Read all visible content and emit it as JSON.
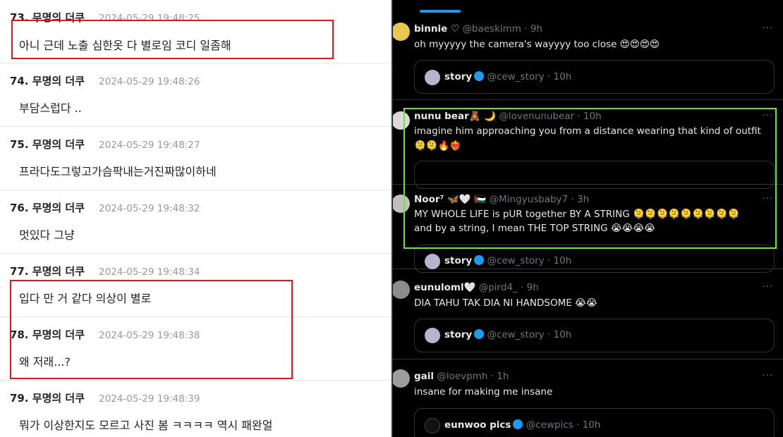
{
  "left": {
    "comments": [
      {
        "name": "73. 무명의 더쿠",
        "date": "2024-05-29 19:48:25",
        "text": "아니 근데 노출 심한옷 다 별로임 코디 일좀해"
      },
      {
        "name": "74. 무명의 더쿠",
        "date": "2024-05-29 19:48:26",
        "text": "부담스럽다 .."
      },
      {
        "name": "75. 무명의 더쿠",
        "date": "2024-05-29 19:48:27",
        "text": "프라다도그렇고가슴팍내는거진짜많이하네"
      },
      {
        "name": "76. 무명의 더쿠",
        "date": "2024-05-29 19:48:32",
        "text": "멋있다 그냥"
      },
      {
        "name": "77. 무명의 더쿠",
        "date": "2024-05-29 19:48:34",
        "text": "입다 만 거 같다 의상이 별로"
      },
      {
        "name": "78. 무명의 더쿠",
        "date": "2024-05-29 19:48:38",
        "text": "왜 저래...?"
      },
      {
        "name": "79. 무명의 더쿠",
        "date": "2024-05-29 19:48:39",
        "text": "뭐가 이상한지도 모르고 사진 봄 ㅋㅋㅋㅋ 역시 패완얼"
      }
    ],
    "highlight_color": "#e4141a"
  },
  "right": {
    "more_label": "···",
    "tweets": [
      {
        "name": "binnie ♡",
        "handle": "@baeskimm · 9h",
        "text": "oh myyyyy the camera's wayyyy too close 😍😍😍😍",
        "quote_name": "story",
        "quote_handle": "@cew_story · 10h"
      },
      {
        "name": "nunu bear🧸 🌙",
        "handle": "@lovenunubear · 10h",
        "text": "imagine him approaching you from a distance wearing that kind of outfit 🫠🫠🔥❤️‍🔥",
        "quote_name": "",
        "quote_handle": ""
      },
      {
        "name": "Noor⁷ 🦋🤍 🇵🇸",
        "handle": "@Mingyusbaby7 · 3h",
        "text": "MY WHOLE LIFE is pUR together BY A STRING 🫠🫠🫠🫠🫠🫠🫠🫠🫠",
        "text2": "and by a string, I mean THE TOP STRING 😭😭😭😭",
        "quote_name": "story",
        "quote_handle": "@cew_story · 10h"
      },
      {
        "name": "eunuloml🤍",
        "handle": "@pird4_ · 9h",
        "text": "DIA TAHU TAK DIA NI HANDSOME 😭😭",
        "quote_name": "story",
        "quote_handle": "@cew_story · 10h"
      },
      {
        "name": "gail",
        "handle": "@loevpmh · 1h",
        "text": "insane for making me insane",
        "quote_name": "eunwoo pics",
        "quote_handle": "@cewpics · 10h"
      }
    ],
    "accent_color": "#1d9bf0",
    "highlight_color": "#6ee42d"
  }
}
